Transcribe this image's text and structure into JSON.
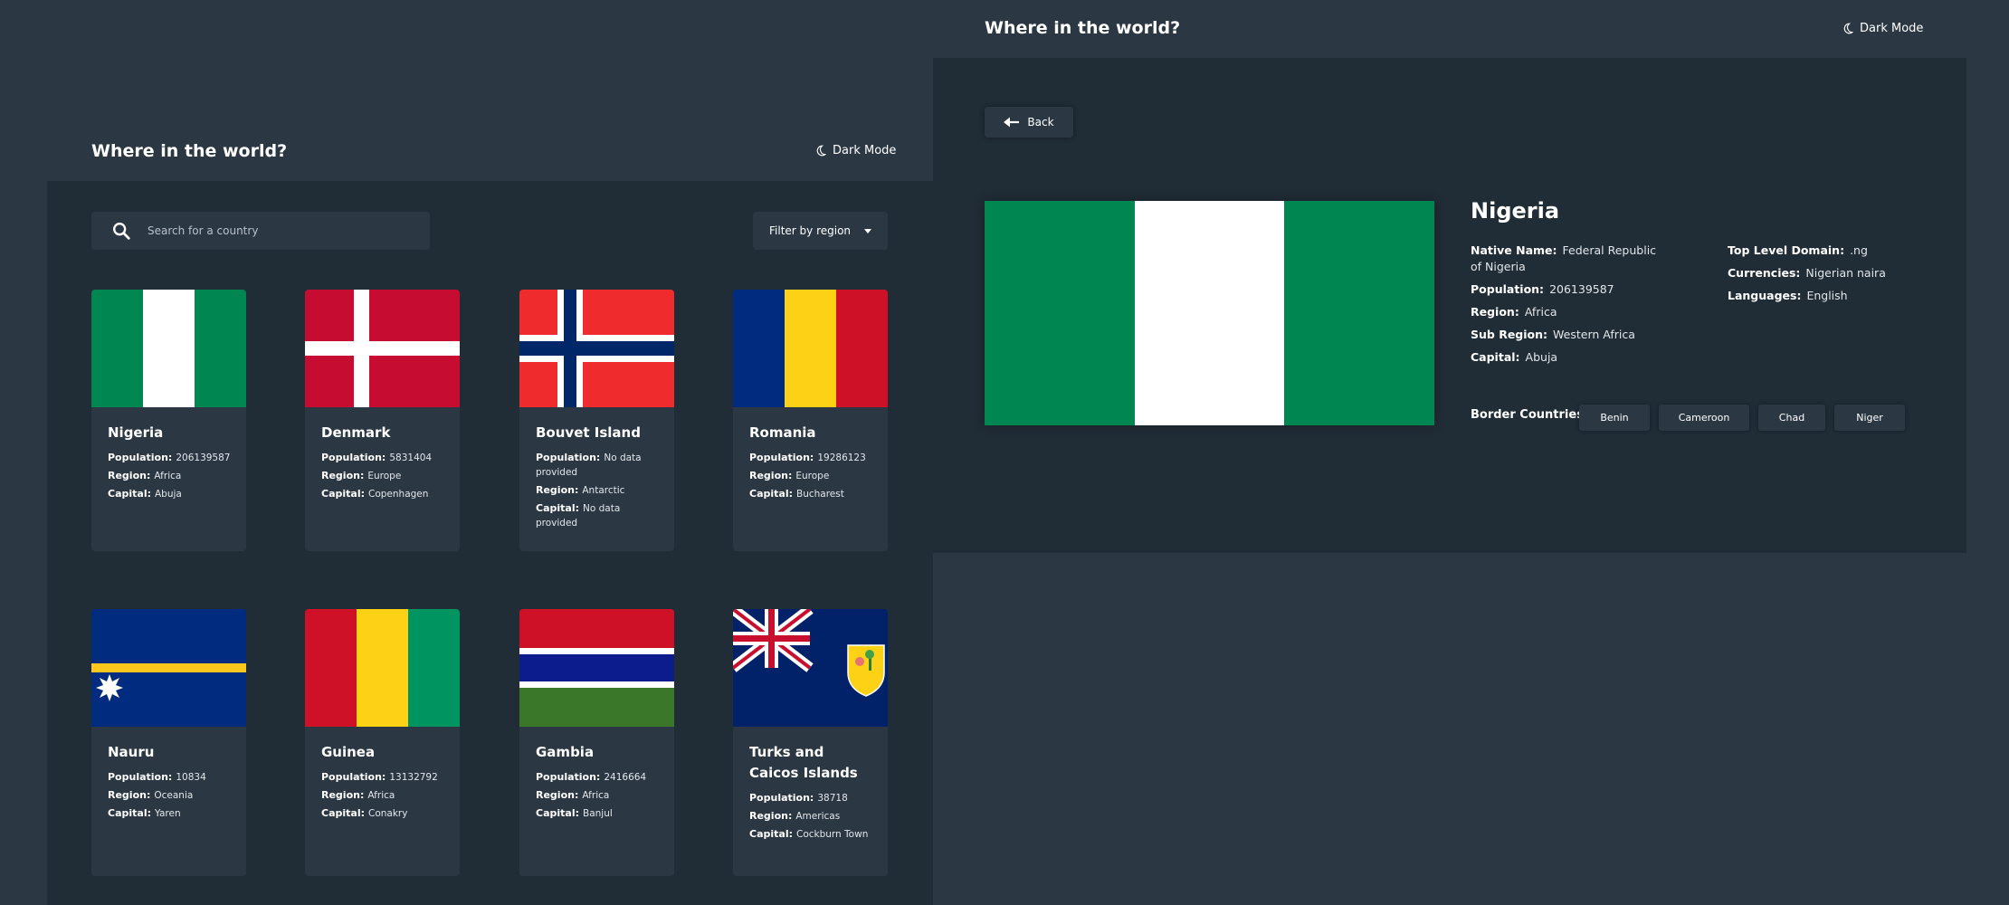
{
  "app_title": "Where in the world?",
  "theme_toggle_label": "Dark Mode",
  "home": {
    "search_placeholder": "Search for a country",
    "filter_label": "Filter by region",
    "labels": {
      "population": "Population:",
      "region": "Region:",
      "capital": "Capital:"
    },
    "countries": [
      {
        "name": "Nigeria",
        "population": "206139587",
        "region": "Africa",
        "capital": "Abuja",
        "flag": "nigeria-flag"
      },
      {
        "name": "Denmark",
        "population": "5831404",
        "region": "Europe",
        "capital": "Copenhagen",
        "flag": "denmark-flag"
      },
      {
        "name": "Bouvet Island",
        "population": "No data provided",
        "region": "Antarctic",
        "capital": "No data provided",
        "flag": "bouvet-island-flag"
      },
      {
        "name": "Romania",
        "population": "19286123",
        "region": "Europe",
        "capital": "Bucharest",
        "flag": "romania-flag"
      },
      {
        "name": "Nauru",
        "population": "10834",
        "region": "Oceania",
        "capital": "Yaren",
        "flag": "nauru-flag"
      },
      {
        "name": "Guinea",
        "population": "13132792",
        "region": "Africa",
        "capital": "Conakry",
        "flag": "guinea-flag"
      },
      {
        "name": "Gambia",
        "population": "2416664",
        "region": "Africa",
        "capital": "Banjul",
        "flag": "gambia-flag"
      },
      {
        "name": "Turks and Caicos Islands",
        "population": "38718",
        "region": "Americas",
        "capital": "Cockburn Town",
        "flag": "turks-and-caicos-flag"
      }
    ]
  },
  "detail": {
    "back_label": "Back",
    "name": "Nigeria",
    "labels": {
      "native_name": "Native Name:",
      "population": "Population:",
      "region": "Region:",
      "sub_region": "Sub Region:",
      "capital": "Capital:",
      "tld": "Top Level Domain:",
      "currencies": "Currencies:",
      "languages": "Languages:",
      "border_countries": "Border Countries:"
    },
    "native_name": "Federal Republic of Nigeria",
    "population": "206139587",
    "region": "Africa",
    "sub_region": "Western Africa",
    "capital": "Abuja",
    "tld": ".ng",
    "currencies": "Nigerian naira",
    "languages": "English",
    "border_countries": [
      "Benin",
      "Cameroon",
      "Chad",
      "Niger"
    ]
  },
  "colors": {
    "background": "#2b3844",
    "main_background": "#202c36",
    "nigeria_green": "#008751"
  }
}
